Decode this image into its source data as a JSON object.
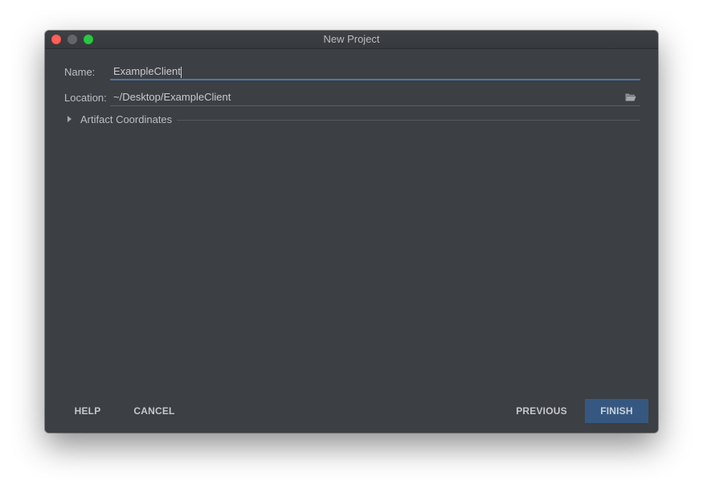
{
  "window": {
    "title": "New Project"
  },
  "form": {
    "name_label": "Name:",
    "name_value": "ExampleClient",
    "location_label": "Location:",
    "location_value": "~/Desktop/ExampleClient",
    "browse_icon": "folder-open-icon"
  },
  "section": {
    "artifact_label": "Artifact Coordinates",
    "expanded": false
  },
  "buttons": {
    "help": "HELP",
    "cancel": "CANCEL",
    "previous": "PREVIOUS",
    "finish": "FINISH"
  },
  "colors": {
    "accent": "#365880",
    "focus_underline": "#4a76ad",
    "background": "#3c3f43"
  }
}
